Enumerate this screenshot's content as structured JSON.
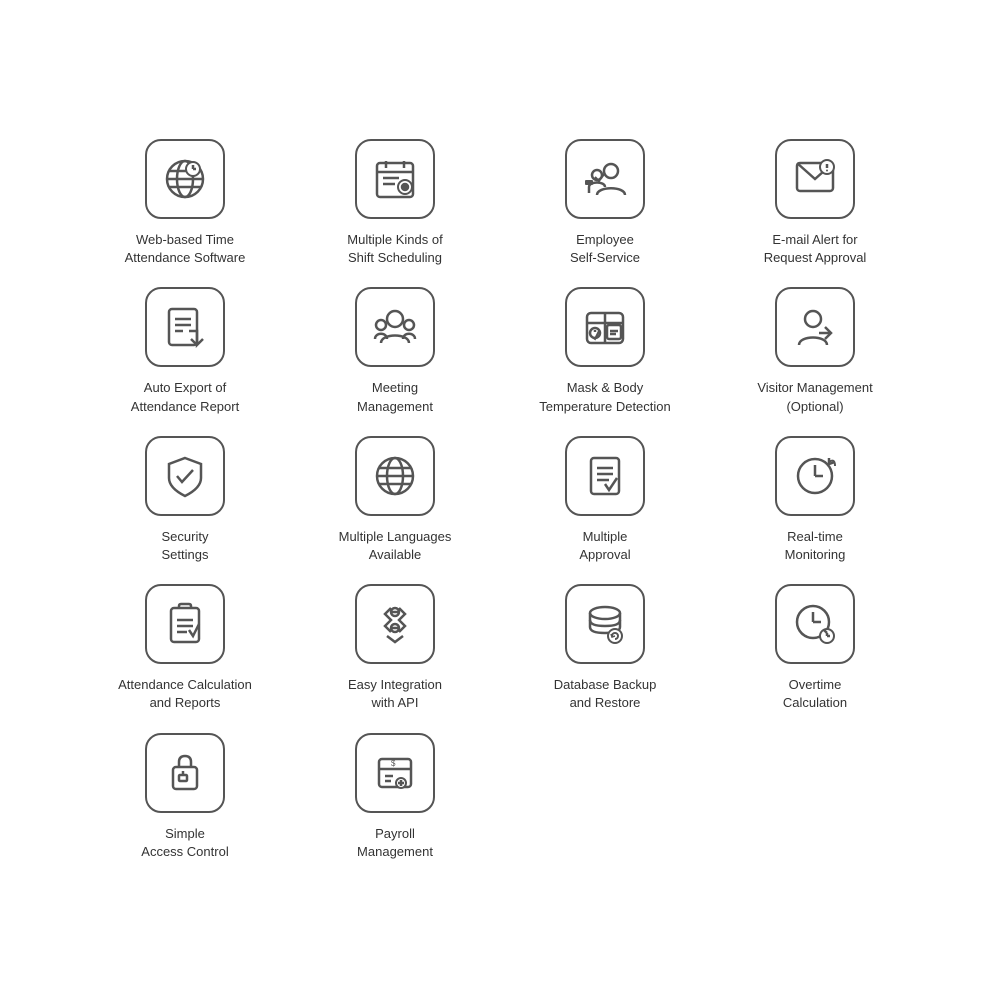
{
  "features": [
    {
      "id": "web-based-time",
      "label": "Web-based Time\nAttendance Software",
      "icon": "globe-clock"
    },
    {
      "id": "multiple-shift",
      "label": "Multiple Kinds of\nShift Scheduling",
      "icon": "calendar-list"
    },
    {
      "id": "employee-self-service",
      "label": "Employee\nSelf-Service",
      "icon": "employee-chart"
    },
    {
      "id": "email-alert",
      "label": "E-mail Alert for\nRequest Approval",
      "icon": "email-monitor"
    },
    {
      "id": "auto-export",
      "label": "Auto Export of\nAttendance Report",
      "icon": "report-export"
    },
    {
      "id": "meeting-management",
      "label": "Meeting\nManagement",
      "icon": "meeting"
    },
    {
      "id": "mask-body-temp",
      "label": "Mask & Body\nTemperature Detection",
      "icon": "medical-kit"
    },
    {
      "id": "visitor-management",
      "label": "Visitor Management\n(Optional)",
      "icon": "visitor"
    },
    {
      "id": "security-settings",
      "label": "Security\nSettings",
      "icon": "shield-check"
    },
    {
      "id": "multiple-languages",
      "label": "Multiple Languages\nAvailable",
      "icon": "globe"
    },
    {
      "id": "multiple-approval",
      "label": "Multiple\nApproval",
      "icon": "checklist"
    },
    {
      "id": "realtime-monitoring",
      "label": "Real-time\nMonitoring",
      "icon": "clock-arrow"
    },
    {
      "id": "attendance-calculation",
      "label": "Attendance Calculation\nand Reports",
      "icon": "clipboard-calc"
    },
    {
      "id": "easy-integration",
      "label": "Easy Integration\nwith API",
      "icon": "puzzle-api"
    },
    {
      "id": "database-backup",
      "label": "Database Backup\nand Restore",
      "icon": "database-gear"
    },
    {
      "id": "overtime-calculation",
      "label": "Overtime\nCalculation",
      "icon": "clock-plus"
    },
    {
      "id": "simple-access",
      "label": "Simple\nAccess Control",
      "icon": "lock-card"
    },
    {
      "id": "payroll-management",
      "label": "Payroll\nManagement",
      "icon": "payroll"
    }
  ]
}
